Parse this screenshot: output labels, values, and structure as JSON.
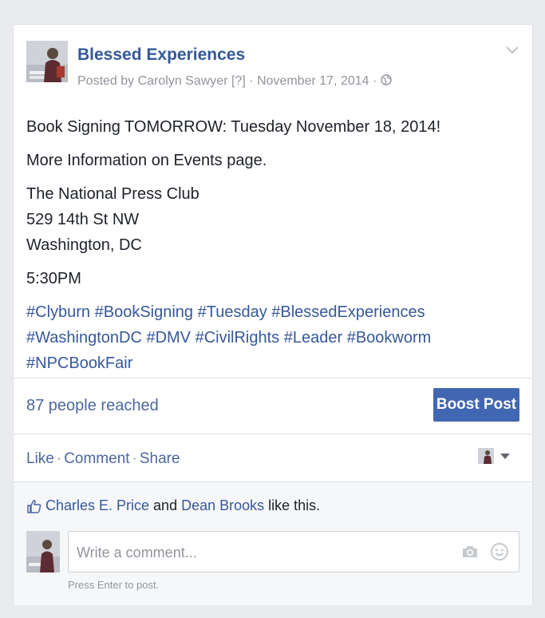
{
  "post": {
    "page_name": "Blessed Experiences",
    "meta": {
      "posted_by": "Posted by Carolyn Sawyer",
      "help": "[?]",
      "dot1": " · ",
      "date": "November 17, 2014",
      "dot2": " · ",
      "privacy_icon": "globe-icon"
    },
    "body": {
      "line1": "Book Signing TOMORROW: Tuesday November 18, 2014!",
      "line2": "More Information on Events page.",
      "address": [
        "The National Press Club",
        "529 14th St NW",
        "Washington, DC"
      ],
      "time": "5:30PM",
      "hashtags": [
        "#Clyburn",
        "#BookSigning",
        "#Tuesday",
        "#BlessedExperiences",
        "#WashingtonDC",
        "#DMV",
        "#CivilRights",
        "#Leader",
        "#Bookworm",
        "#NPCBookFair"
      ]
    }
  },
  "insights": {
    "reach": "87 people reached",
    "boost_label": "Boost Post"
  },
  "actions": {
    "like": "Like",
    "comment": "Comment",
    "share": "Share",
    "separator": "·"
  },
  "likes": {
    "person1": "Charles E. Price",
    "and": " and ",
    "person2": "Dean Brooks",
    "suffix": " like this."
  },
  "composer": {
    "placeholder": "Write a comment...",
    "hint": "Press Enter to post."
  },
  "colors": {
    "link": "#365899",
    "accent": "#4267b2",
    "muted": "#90949c"
  }
}
